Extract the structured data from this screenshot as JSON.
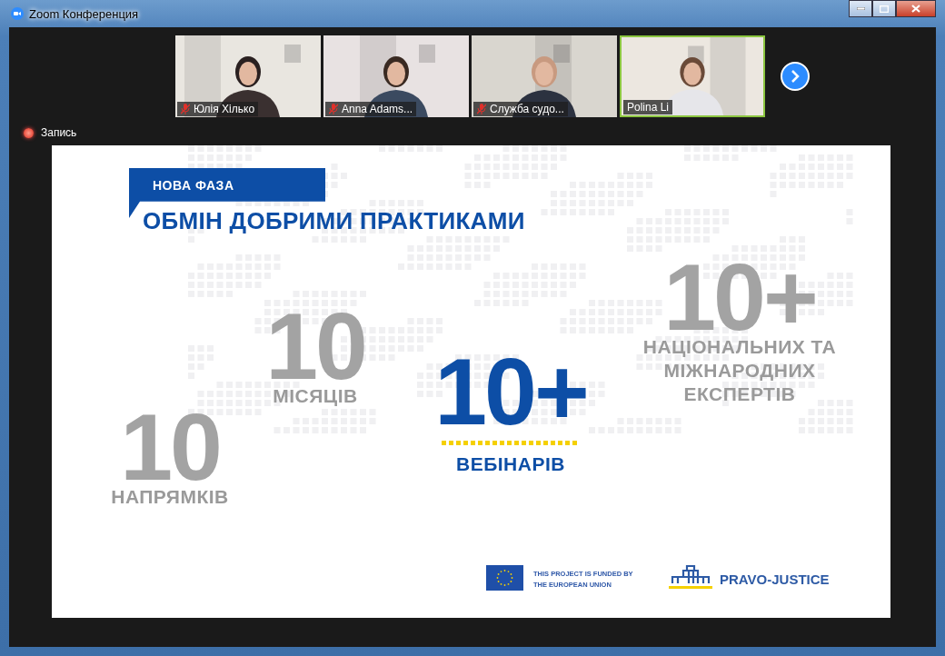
{
  "window": {
    "title": "Zoom Конференция"
  },
  "participants": [
    {
      "name": "Юлія Хілько",
      "muted": true,
      "speaking": false
    },
    {
      "name": "Anna Adams...",
      "muted": true,
      "speaking": false
    },
    {
      "name": "Служба судо...",
      "muted": true,
      "speaking": false
    },
    {
      "name": "Polina Li",
      "muted": false,
      "speaking": true
    }
  ],
  "recording": {
    "label": "Запись"
  },
  "slide": {
    "tag": "НОВА ФАЗА",
    "title": "ОБМІН ДОБРИМИ ПРАКТИКАМИ",
    "stats": [
      {
        "value": "10",
        "label": "НАПРЯМКІВ",
        "kind": "plain"
      },
      {
        "value": "10",
        "label": "МІСЯЦІВ",
        "kind": "plain"
      },
      {
        "value": "10+",
        "label": "ВЕБІНАРІВ",
        "kind": "accent"
      },
      {
        "value": "10+",
        "label": "НАЦІОНАЛЬНИХ ТА МІЖНАРОДНИХ ЕКСПЕРТІВ",
        "kind": "plain"
      }
    ],
    "funding": "THIS PROJECT IS FUNDED BY THE EUROPEAN UNION",
    "brand": "PRAVO-JUSTICE"
  }
}
